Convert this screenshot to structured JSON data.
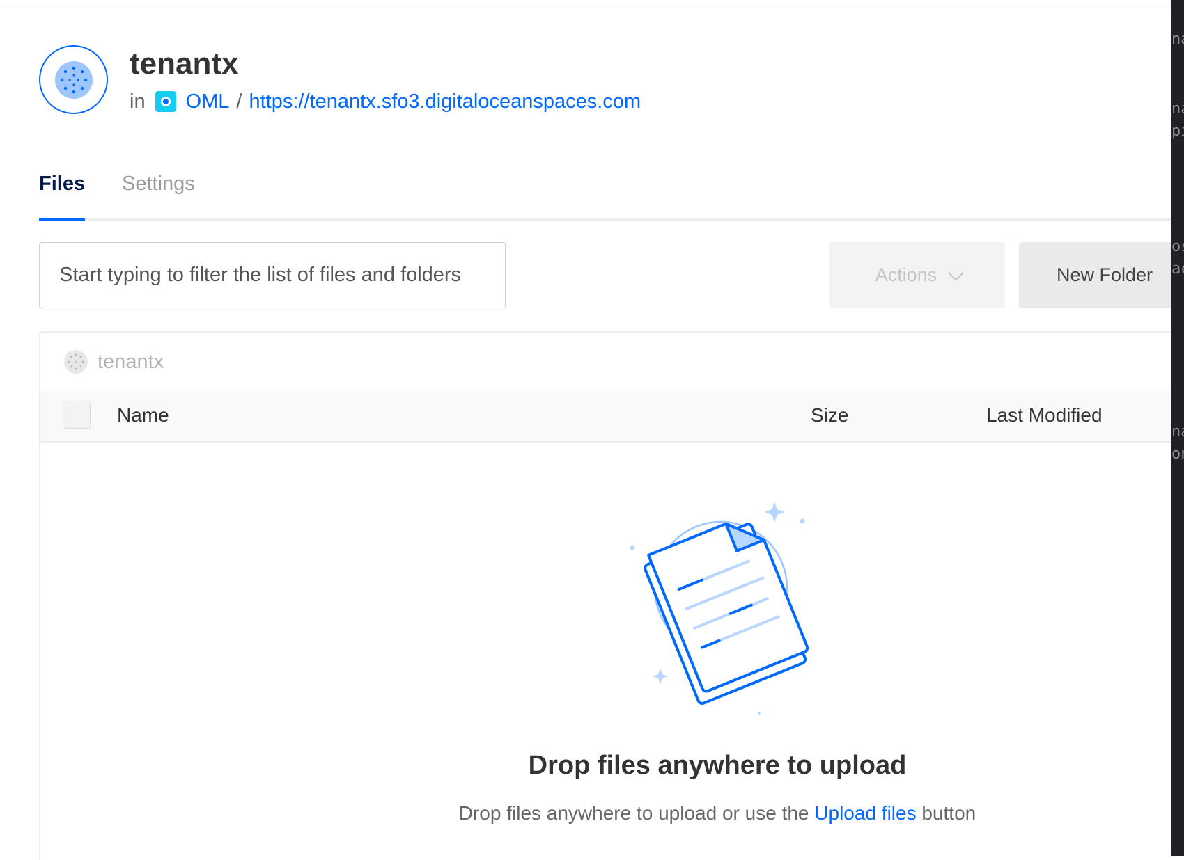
{
  "space": {
    "name": "tenantx",
    "in_label": "in",
    "project": "OML",
    "separator": "/",
    "endpoint": "https://tenantx.sfo3.digitaloceanspaces.com"
  },
  "tabs": [
    {
      "label": "Files",
      "active": true
    },
    {
      "label": "Settings",
      "active": false
    }
  ],
  "filter": {
    "placeholder": "Start typing to filter the list of files and folders",
    "value": ""
  },
  "toolbar": {
    "actions_label": "Actions",
    "new_folder_label": "New Folder"
  },
  "breadcrumb": {
    "label": "tenantx"
  },
  "table": {
    "columns": [
      "Name",
      "Size",
      "Last Modified"
    ]
  },
  "empty_state": {
    "title": "Drop files anywhere to upload",
    "subtitle_before": "Drop files anywhere to upload or use the ",
    "subtitle_link": "Upload files",
    "subtitle_after": " button"
  },
  "side_fragments": [
    "na",
    "na",
    "pi",
    "os",
    "ac",
    "na",
    "on"
  ],
  "colors": {
    "accent": "#0069ff",
    "project_icon": "#15cdf0",
    "tab_active": "#031b4e"
  },
  "icons": [
    "space-avatar-icon",
    "project-icon",
    "chevron-down-icon",
    "breadcrumb-space-icon",
    "empty-document-illustration"
  ]
}
